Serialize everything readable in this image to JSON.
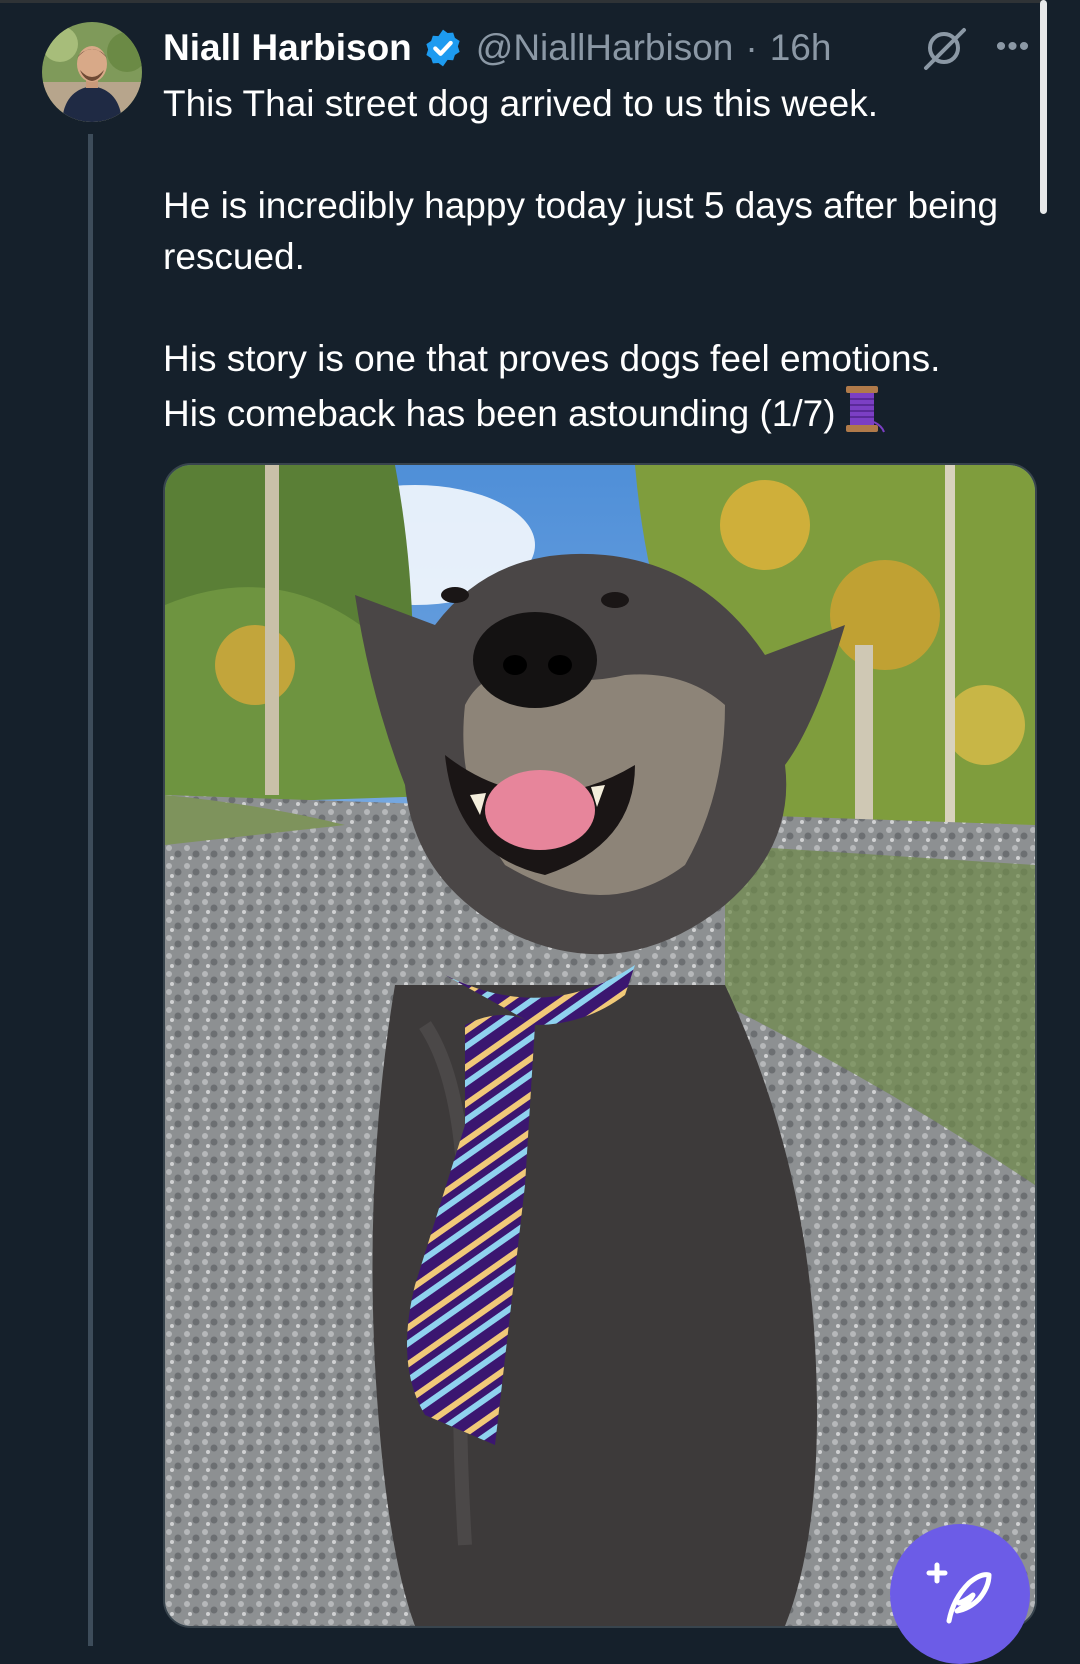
{
  "tweet": {
    "author_name": "Niall Harbison",
    "handle": "@NiallHarbison",
    "separator": "·",
    "time": "16h",
    "text_lines": [
      "This Thai street dog arrived to us this week.",
      "He is incredibly happy today just 5 days after being rescued.",
      "His story is one that proves dogs feel emotions.",
      "His comeback has been astounding (1/7)"
    ],
    "media_icon": "dog-photo",
    "thread_emoji_icon": "spool-of-thread-icon",
    "verified_icon": "verified-badge-icon",
    "more_icon": "more-options-icon"
  },
  "fab": {
    "icon": "compose-tweet-icon"
  },
  "colors": {
    "background": "#15202b",
    "text": "#ffffff",
    "secondary_text": "#8b98a5",
    "verified_blue": "#1d9bf0",
    "fab": "#6c5ce7",
    "thread_line": "#3d4c5a"
  }
}
